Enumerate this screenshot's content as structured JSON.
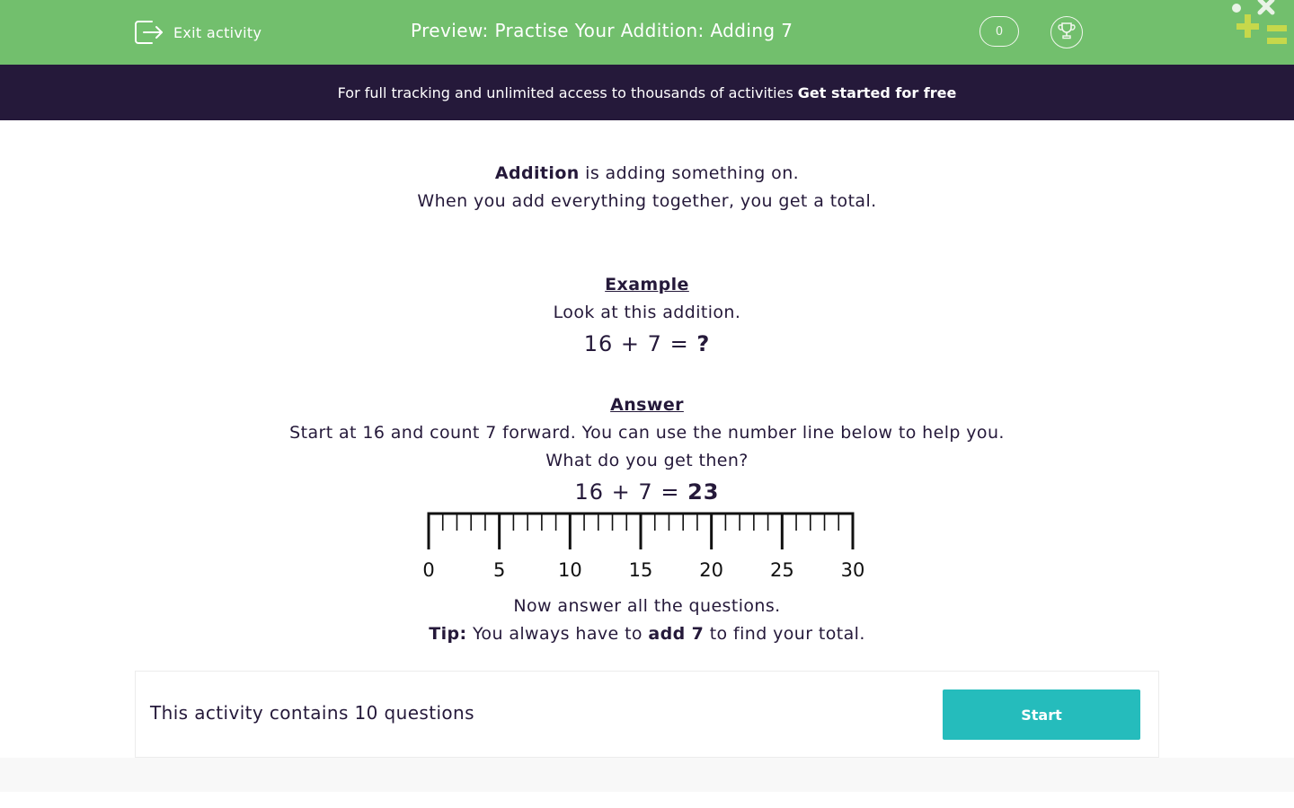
{
  "header": {
    "exit_label": "Exit activity",
    "title": "Preview: Practise Your Addition: Adding 7",
    "score": "0"
  },
  "banner": {
    "text": "For full tracking and unlimited access to thousands of activities",
    "link": "Get started for free"
  },
  "intro": {
    "line1_bold": "Addition",
    "line1_rest": " is adding something on.",
    "line2": "When you add everything together, you get a total."
  },
  "example": {
    "heading": "Example",
    "text": "Look at this addition.",
    "equation": "16 + 7 = ",
    "unknown": "?"
  },
  "answer": {
    "heading": "Answer",
    "line1": "Start at 16 and count 7 forward. You can use the number line below to help you.",
    "line2": "What do you get then?",
    "equation": "16 + 7 = ",
    "result": "23"
  },
  "number_line": {
    "min": 0,
    "max": 30,
    "major_step": 5,
    "labels": [
      "0",
      "5",
      "10",
      "15",
      "20",
      "25",
      "30"
    ]
  },
  "outro": {
    "line1": "Now answer all the questions.",
    "tip_label": "Tip:",
    "tip_pre": " You always have to ",
    "tip_bold": "add 7",
    "tip_post": " to find your total."
  },
  "card": {
    "text": "This activity contains 10 questions",
    "start_label": "Start"
  },
  "colors": {
    "header_green": "#72bf6d",
    "banner_dark": "#25193a",
    "start_teal": "#25bcbc",
    "logo_lime": "#c6d84b"
  }
}
